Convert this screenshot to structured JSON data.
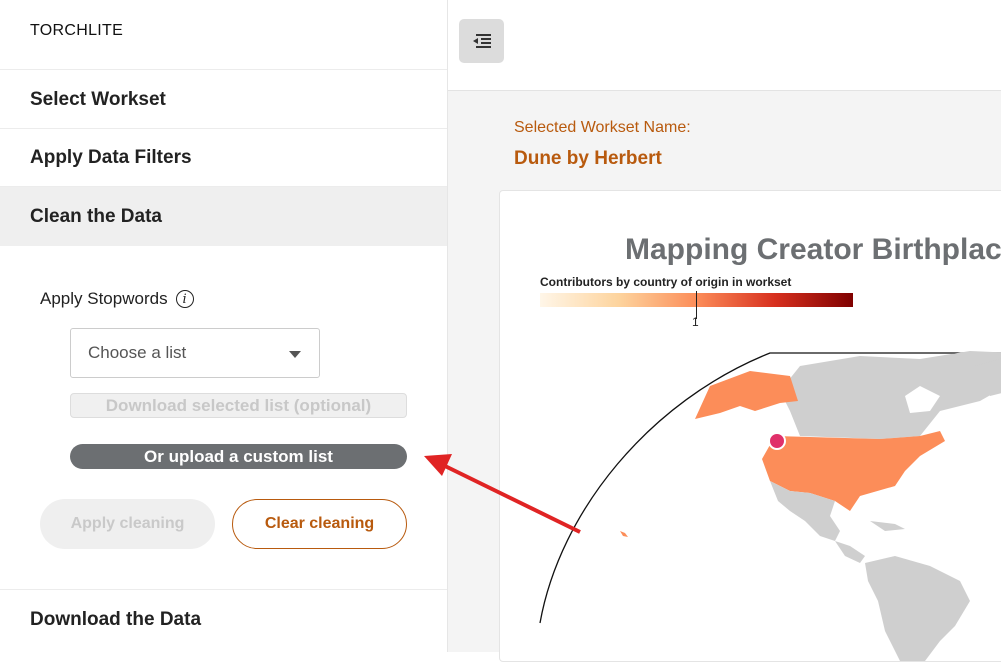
{
  "sidebar": {
    "brand": "TORCHLITE",
    "sections": [
      {
        "label": "Select Workset"
      },
      {
        "label": "Apply Data Filters"
      },
      {
        "label": "Clean the Data"
      },
      {
        "label": "Download the Data"
      }
    ],
    "clean": {
      "stopwords_label": "Apply Stopwords",
      "info_glyph": "i",
      "select_value": "Choose a list",
      "download_button": "Download selected list (optional)",
      "upload_button": "Or upload a custom list",
      "apply_button": "Apply cleaning",
      "clear_button": "Clear cleaning"
    }
  },
  "main": {
    "workset_label": "Selected Workset Name:",
    "workset_name": "Dune by Herbert",
    "map": {
      "title": "Mapping Creator Birthplac",
      "legend_title": "Contributors by country of origin in workset",
      "legend_tick": "1"
    }
  },
  "colors": {
    "accent": "#b85a0e",
    "highlight_country": "#fc8d59",
    "marker": "#e0306a",
    "arrow": "#e02424"
  },
  "icons": {
    "sidebar_toggle": "indent-decrease-icon",
    "info": "info-icon",
    "caret": "chevron-down-icon"
  }
}
